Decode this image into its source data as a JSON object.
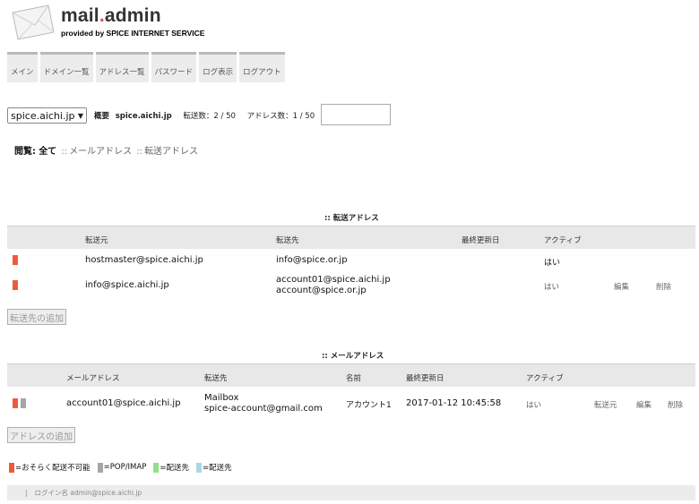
{
  "brand": {
    "name_prefix": "mail",
    "name_dot": ".",
    "name_suffix": "admin",
    "tagline": "provided by SPICE INTERNET SERVICE"
  },
  "nav": {
    "tabs": [
      "メイン",
      "ドメイン一覧",
      "アドレス一覧",
      "パスワード",
      "ログ表示",
      "ログアウト"
    ]
  },
  "domain_bar": {
    "selected_domain": "spice.aichi.jp",
    "overview_label": "概要",
    "overview_domain": "spice.aichi.jp",
    "forward_count": "転送数：2 / 50",
    "address_count": "アドレス数：1 / 50",
    "search_value": ""
  },
  "filter": {
    "label": "閲覧:",
    "selected": "全て",
    "sep": "::",
    "options": [
      "メールアドレス",
      "転送アドレス"
    ]
  },
  "forward_section": {
    "title": ":: 転送アドレス",
    "headers": [
      "転送元",
      "転送先",
      "最終更新日",
      "アクティブ"
    ],
    "rows": [
      {
        "source": "hostmaster@spice.aichi.jp",
        "dest_line1": "info@spice.or.jp",
        "dest_line2": "",
        "updated": "",
        "active": "はい",
        "edit": "",
        "delete": ""
      },
      {
        "source": "info@spice.aichi.jp",
        "dest_line1": "account01@spice.aichi.jp",
        "dest_line2": "account@spice.or.jp",
        "updated": "",
        "active": "はい",
        "edit": "編集",
        "delete": "削除"
      }
    ],
    "add_button": "転送先の追加"
  },
  "mail_section": {
    "title": ":: メールアドレス",
    "headers": [
      "メールアドレス",
      "転送先",
      "名前",
      "最終更新日",
      "アクティブ"
    ],
    "rows": [
      {
        "address": "account01@spice.aichi.jp",
        "dest_line1": "Mailbox",
        "dest_line2": "spice-account@gmail.com",
        "name": "アカウント1",
        "updated": "2017-01-12 10:45:58",
        "active": "はい",
        "forward": "転送元",
        "edit": "編集",
        "delete": "削除"
      }
    ],
    "add_button": "アドレスの追加"
  },
  "legend": [
    {
      "color": "#f05a3c",
      "label": "=おそらく配送不可能"
    },
    {
      "color": "#a6a6a6",
      "label": "=POP/IMAP"
    },
    {
      "color": "#8fe08a",
      "label": "=配送先"
    },
    {
      "color": "#a8d8e8",
      "label": "=配送先"
    }
  ],
  "footer": {
    "bar": "|",
    "login": "ログイン名 admin@spice.aichi.jp"
  },
  "colors": {
    "undeliverable": "#f05a3c",
    "pop_imap": "#a6a6a6"
  },
  "icons": [
    "envelope-logo-icon",
    "chevron-down-icon"
  ]
}
